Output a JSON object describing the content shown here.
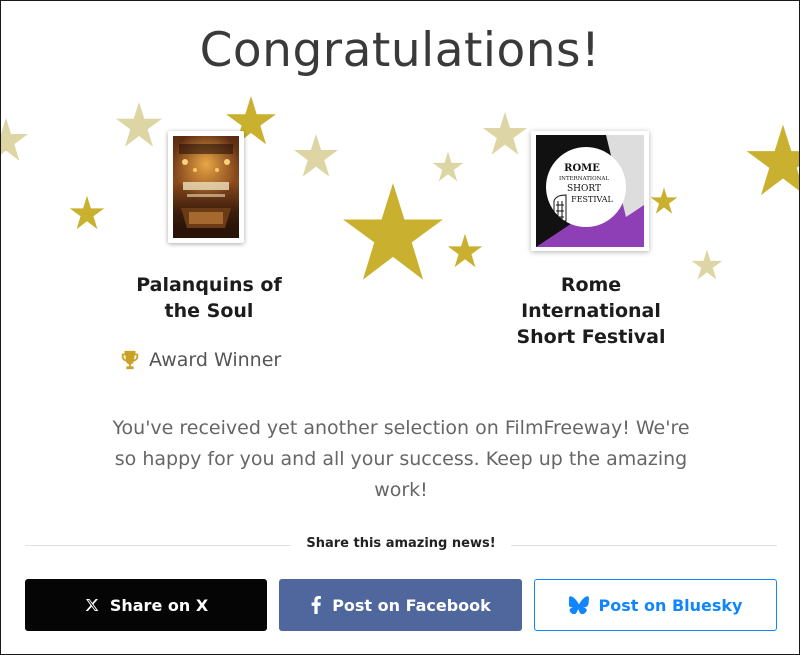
{
  "header": {
    "title": "Congratulations!"
  },
  "film": {
    "title_line1": "Palanquins of",
    "title_line2": "the Soul",
    "award_label": "Award Winner",
    "poster_icon": "film-poster-image",
    "trophy_icon": "trophy-icon"
  },
  "festival": {
    "name_line1": "Rome",
    "name_line2": "International",
    "name_line3": "Short Festival",
    "logo_text_line1": "ROME",
    "logo_text_line2": "INTERNATIONAL",
    "logo_text_line3": "SHORT",
    "logo_text_line4": "FESTIVAL"
  },
  "message": {
    "line1": "You've received yet another selection on FilmFreeway! We're",
    "line2": "so happy for you and all your success. Keep up the amazing",
    "line3": "work!"
  },
  "share": {
    "heading": "Share this amazing news!",
    "x_label": "Share on X",
    "facebook_label": "Post on Facebook",
    "bluesky_label": "Post on Bluesky"
  },
  "colors": {
    "star": "#c9b12f",
    "x_button": "#050505",
    "facebook_button": "#4f679c",
    "bluesky": "#1185fe"
  }
}
